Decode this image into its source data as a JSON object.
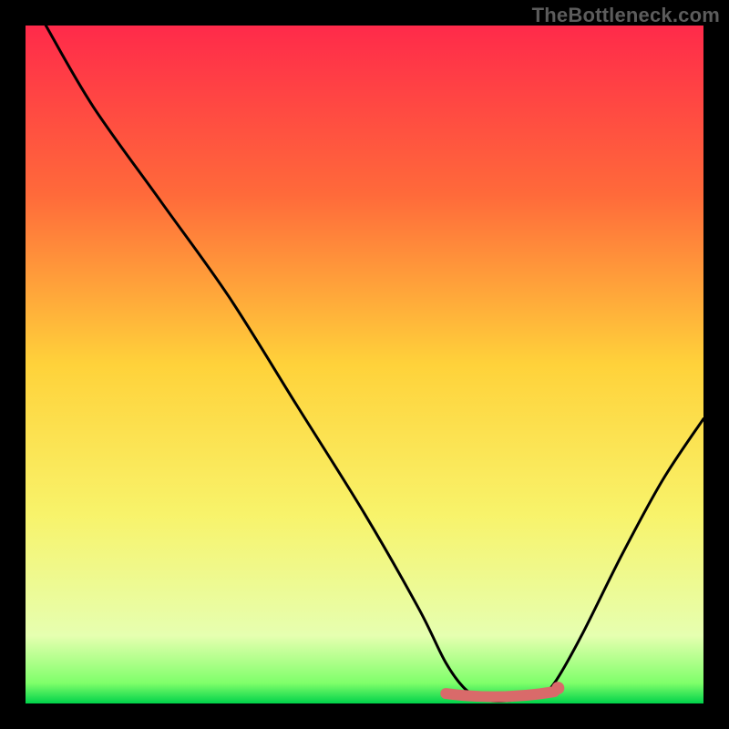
{
  "watermark": "TheBottleneck.com",
  "chart_data": {
    "type": "line",
    "title": "",
    "xlabel": "",
    "ylabel": "",
    "xlim": [
      0,
      100
    ],
    "ylim": [
      0,
      100
    ],
    "curve_points": [
      {
        "x": 3,
        "y": 100
      },
      {
        "x": 10,
        "y": 88
      },
      {
        "x": 20,
        "y": 74
      },
      {
        "x": 30,
        "y": 60
      },
      {
        "x": 40,
        "y": 44
      },
      {
        "x": 50,
        "y": 28
      },
      {
        "x": 58,
        "y": 14
      },
      {
        "x": 62,
        "y": 6
      },
      {
        "x": 65,
        "y": 2
      },
      {
        "x": 68,
        "y": 0.5
      },
      {
        "x": 72,
        "y": 0.5
      },
      {
        "x": 76,
        "y": 1.5
      },
      {
        "x": 78,
        "y": 3
      },
      {
        "x": 82,
        "y": 10
      },
      {
        "x": 88,
        "y": 22
      },
      {
        "x": 94,
        "y": 33
      },
      {
        "x": 100,
        "y": 42
      }
    ],
    "highlight_band": {
      "x_start": 62,
      "x_end": 78,
      "y": 1.2
    },
    "gradient_stops": [
      {
        "offset": 0.0,
        "color": "#ff2a4a"
      },
      {
        "offset": 0.25,
        "color": "#ff6a3a"
      },
      {
        "offset": 0.5,
        "color": "#ffd23a"
      },
      {
        "offset": 0.72,
        "color": "#f8f36a"
      },
      {
        "offset": 0.9,
        "color": "#e6ffb0"
      },
      {
        "offset": 0.97,
        "color": "#7fff6a"
      },
      {
        "offset": 1.0,
        "color": "#00d24a"
      }
    ],
    "highlight_color": "#d96a6a",
    "curve_color": "#000000"
  }
}
